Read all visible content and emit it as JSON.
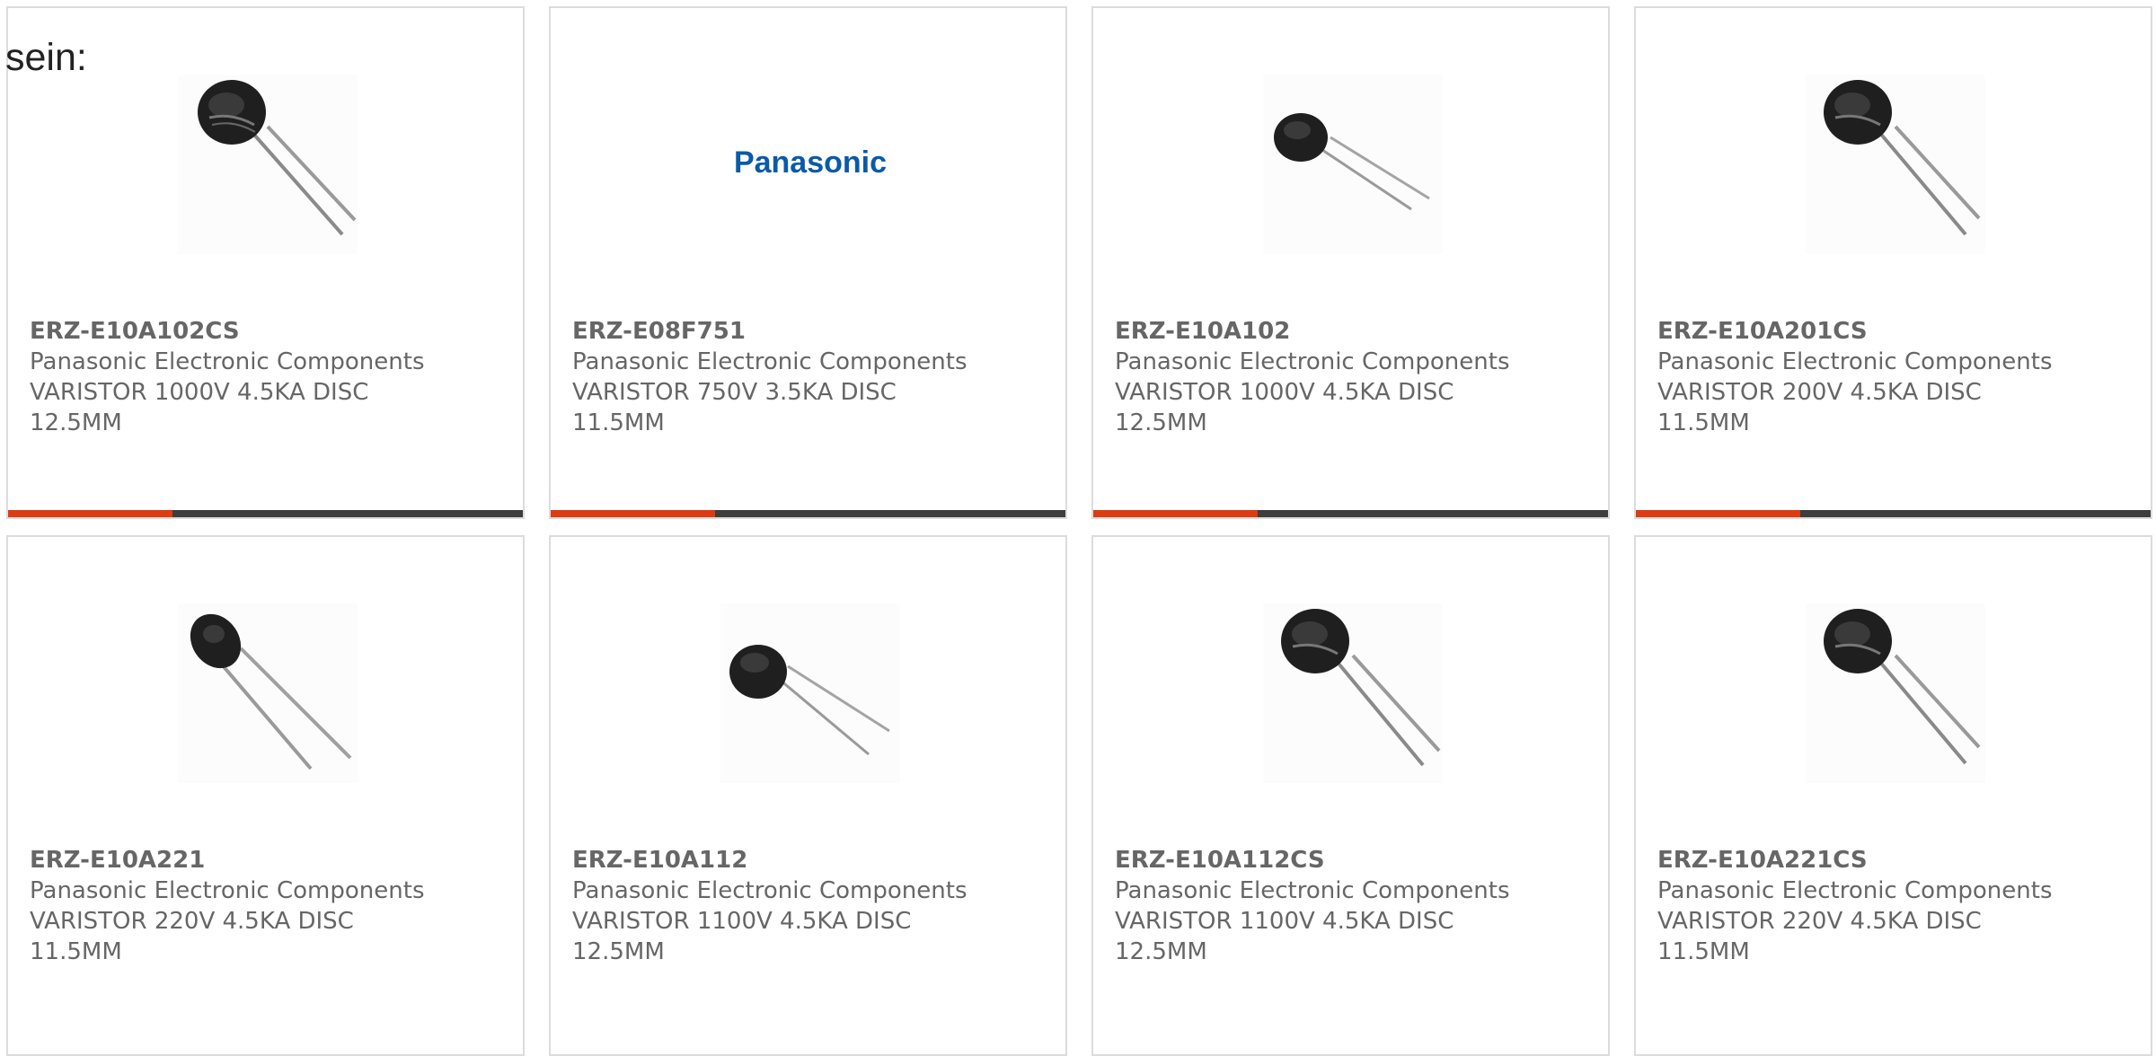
{
  "intro_text": "sein:",
  "colors": {
    "accent": "#dd3c13",
    "bar": "#3d3d3d",
    "border": "#dcdcdc",
    "text": "#666666",
    "brand_logo": "#0a5aa8"
  },
  "products": [
    {
      "part": "ERZ-E10A102CS",
      "manufacturer": "Panasonic Electronic Components",
      "description": "VARISTOR 1000V 4.5KA DISC 12.5MM",
      "image": "varistor-disc-icon"
    },
    {
      "part": "ERZ-E08F751",
      "manufacturer": "Panasonic Electronic Components",
      "description": "VARISTOR 750V 3.5KA DISC 11.5MM",
      "image": "panasonic-logo",
      "logo_text": "Panasonic"
    },
    {
      "part": "ERZ-E10A102",
      "manufacturer": "Panasonic Electronic Components",
      "description": "VARISTOR 1000V 4.5KA DISC 12.5MM",
      "image": "varistor-disc-icon"
    },
    {
      "part": "ERZ-E10A201CS",
      "manufacturer": "Panasonic Electronic Components",
      "description": "VARISTOR 200V 4.5KA DISC 11.5MM",
      "image": "varistor-disc-icon"
    },
    {
      "part": "ERZ-E10A221",
      "manufacturer": "Panasonic Electronic Components",
      "description": "VARISTOR 220V 4.5KA DISC 11.5MM",
      "image": "varistor-disc-icon"
    },
    {
      "part": "ERZ-E10A112",
      "manufacturer": "Panasonic Electronic Components",
      "description": "VARISTOR 1100V 4.5KA DISC 12.5MM",
      "image": "varistor-disc-icon"
    },
    {
      "part": "ERZ-E10A112CS",
      "manufacturer": "Panasonic Electronic Components",
      "description": "VARISTOR 1100V 4.5KA DISC 12.5MM",
      "image": "varistor-disc-icon"
    },
    {
      "part": "ERZ-E10A221CS",
      "manufacturer": "Panasonic Electronic Components",
      "description": "VARISTOR 220V 4.5KA DISC 11.5MM",
      "image": "varistor-disc-icon"
    }
  ]
}
